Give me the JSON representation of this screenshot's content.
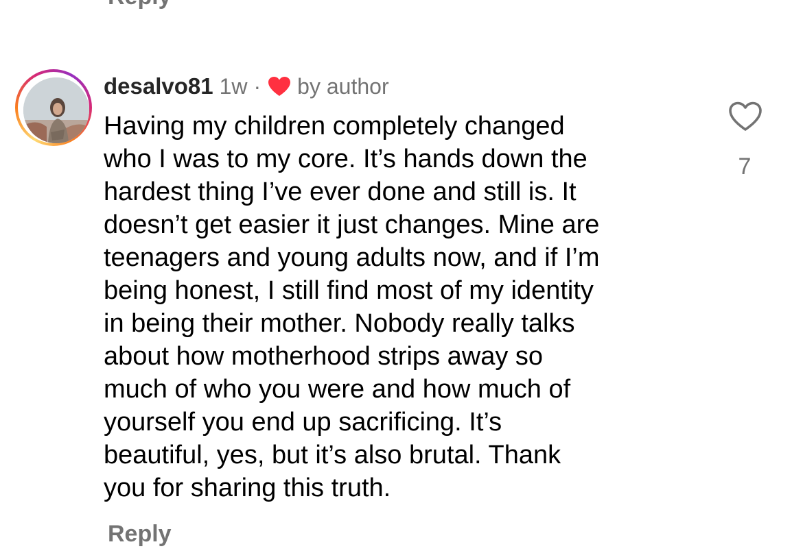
{
  "previous_comment": {
    "reply_label": "Reply"
  },
  "comment": {
    "username": "desalvo81",
    "time": "1w",
    "separator": "·",
    "author_like_label": "by author",
    "author_heart_color": "#ff3040",
    "text_lines": [
      "Having my children completely changed",
      "who I was to my core. It’s hands down the",
      "hardest thing I’ve ever done and still is. It",
      "doesn’t get easier it just changes. Mine are",
      "teenagers and young adults now, and if I’m",
      "being honest, I still find most of my identity",
      "in being their mother. Nobody really talks",
      "about how motherhood strips away so",
      "much of who you were and how much of",
      "yourself you end up sacrificing. It’s",
      "beautiful, yes, but it’s also brutal. Thank",
      "you for sharing this truth."
    ],
    "like_icon": "heart-outline-icon",
    "like_count": "7",
    "reply_label": "Reply"
  }
}
